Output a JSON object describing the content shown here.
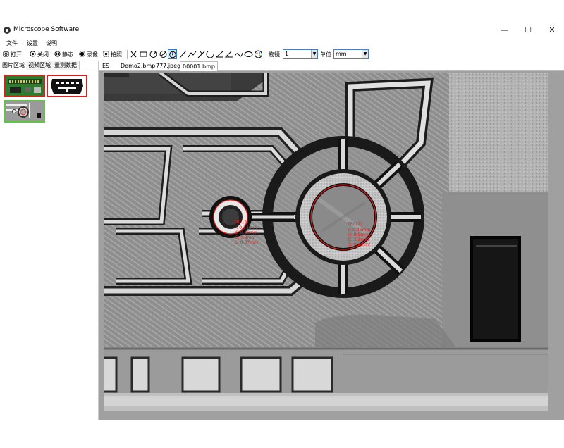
{
  "window": {
    "title": "Microscope Software",
    "minimize": "—",
    "maximize": "☐",
    "close": "✕"
  },
  "menu": [
    "文件",
    "设置",
    "说明"
  ],
  "toolbar": {
    "open_label": "打开",
    "close_label": "关闭",
    "still_label": "静态",
    "record_label": "录像",
    "capture_label": "拍照",
    "objective_label": "物镜",
    "objective_value": "1",
    "unit_label": "单位",
    "unit_value": "mm"
  },
  "left_tabs": [
    "图片区域",
    "视频区域",
    "量测数据"
  ],
  "doc_tabs": [
    "ES",
    "Demo2.bmp",
    "777.jpeg",
    "00001.bmp"
  ],
  "annotations": {
    "small_circle": {
      "title": "TRC(1)",
      "lines": [
        "r: 0.14mm",
        "d: 0.29mm",
        "C: 0.9mm",
        "S: 0.07mm²"
      ]
    },
    "large_circle": {
      "title": "TRC(2)",
      "lines": [
        "r: 0.45mm",
        "d: 0.9mm",
        "C: 2.8mm",
        "S: 0.6mm²"
      ]
    }
  },
  "colors": {
    "accent": "#3377cc",
    "thumb_selected": "#d32020",
    "thumb_video": "#5ec548",
    "measure": "#e02020"
  }
}
